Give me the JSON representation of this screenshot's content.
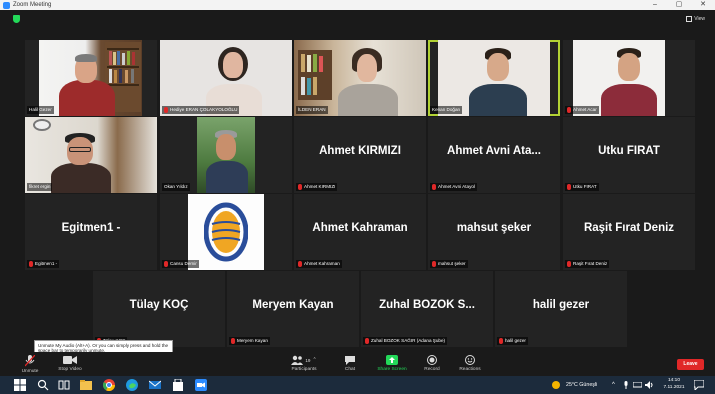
{
  "window": {
    "title": "Zoom Meeting",
    "minimize": "–",
    "restore": "▢",
    "close": "✕"
  },
  "topbar": {
    "view_label": "View"
  },
  "tiles": [
    {
      "id": "t1",
      "label": "Halil Gezer",
      "name": "",
      "muted": false,
      "video": true
    },
    {
      "id": "t2",
      "label": "Hediye ERAN ÇOLAKYOLOĞLU",
      "name": "",
      "muted": true,
      "video": true
    },
    {
      "id": "t3",
      "label": "İLDEN ERAN",
      "name": "",
      "muted": false,
      "video": true
    },
    {
      "id": "t4",
      "label": "Kenan Doğan",
      "name": "",
      "muted": false,
      "video": true,
      "active": true
    },
    {
      "id": "t5",
      "label": "Ahmet Acar",
      "name": "",
      "muted": true,
      "video": true
    },
    {
      "id": "t6",
      "label": "fikret ergin",
      "name": "",
      "muted": false,
      "video": true
    },
    {
      "id": "t7",
      "label": "Okan Yıldız",
      "name": "",
      "muted": false,
      "video": true
    },
    {
      "id": "t8",
      "label": "Ahmet KIRMIZI",
      "name": "Ahmet KIRMIZI",
      "muted": true,
      "video": false
    },
    {
      "id": "t9",
      "label": "Ahmet Avni Atayol",
      "name": "Ahmet Avni Ata...",
      "muted": true,
      "video": false
    },
    {
      "id": "t10",
      "label": "Utku FIRAT",
      "name": "Utku FIRAT",
      "muted": true,
      "video": false
    },
    {
      "id": "t11",
      "label": "Egitmen1 -",
      "name": "Egitmen1 -",
      "muted": true,
      "video": false
    },
    {
      "id": "t12",
      "label": "Cansu Demir",
      "name": "",
      "muted": true,
      "video": true
    },
    {
      "id": "t13",
      "label": "Ahmet Kahraman",
      "name": "Ahmet Kahraman",
      "muted": true,
      "video": false
    },
    {
      "id": "t14",
      "label": "mahsut şeker",
      "name": "mahsut şeker",
      "muted": true,
      "video": false
    },
    {
      "id": "t15",
      "label": "Raşit Fırat Deniz",
      "name": "Raşit Fırat Deniz",
      "muted": true,
      "video": false
    },
    {
      "id": "t16",
      "label": "Tülay KOÇ",
      "name": "Tülay KOÇ",
      "muted": true,
      "video": false
    },
    {
      "id": "t17",
      "label": "Meryem Kayan",
      "name": "Meryem Kayan",
      "muted": true,
      "video": false
    },
    {
      "id": "t18",
      "label": "Zuhal BOZOK SAĞIR (Adana Şube)",
      "name": "Zuhal BOZOK S...",
      "muted": true,
      "video": false
    },
    {
      "id": "t19",
      "label": "halil gezer",
      "name": "halil gezer",
      "muted": true,
      "video": false
    }
  ],
  "toolbar": {
    "unmute": "Unmute",
    "stop_video": "Stop Video",
    "participants": "Participants",
    "participants_count": "19",
    "chat": "Chat",
    "share_screen": "Share Screen",
    "record": "Record",
    "reactions": "Reactions",
    "leave": "Leave"
  },
  "tooltip": "Unmute My Audio (Alt+A). Or you can simply press and hold the space bar to temporarily unmute.",
  "taskbar": {
    "weather": "25°C Güneşli",
    "time": "14:10",
    "date": "7.11.2021"
  },
  "colors": {
    "active_speaker": "#b2d234",
    "leave": "#e02828",
    "share": "#23d959",
    "muted_mic": "#e02828"
  }
}
